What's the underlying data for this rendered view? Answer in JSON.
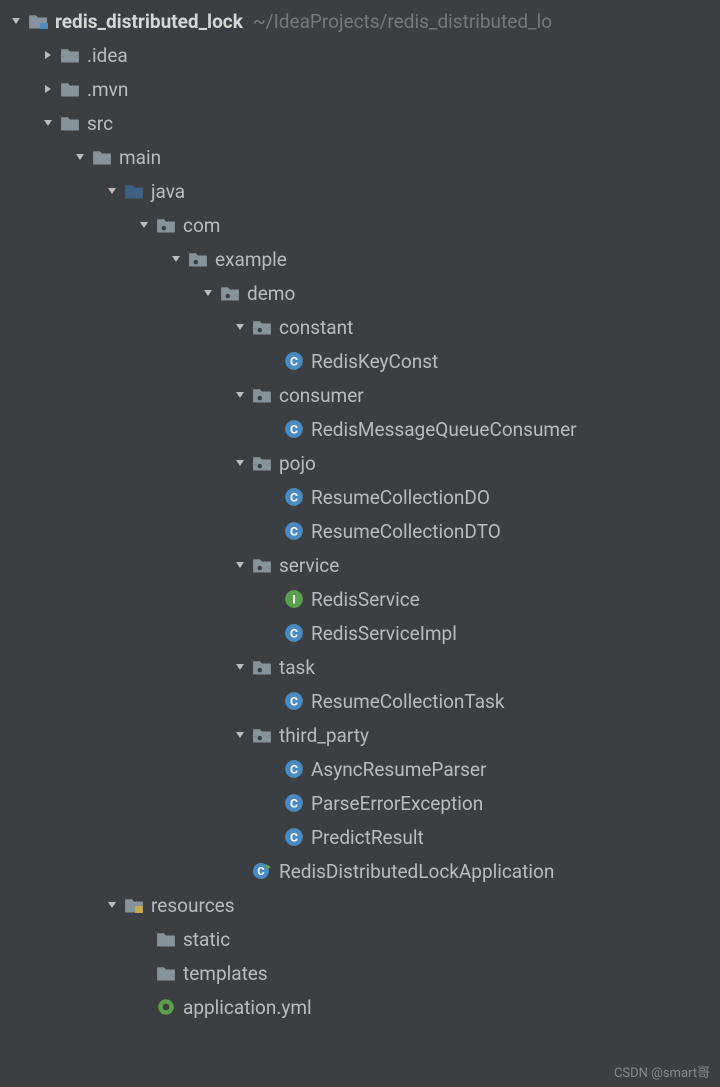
{
  "root": {
    "name": "redis_distributed_lock",
    "path": "~/IdeaProjects/redis_distributed_lo"
  },
  "nodes": {
    "idea": ".idea",
    "mvn": ".mvn",
    "src": "src",
    "main": "main",
    "java": "java",
    "com": "com",
    "example": "example",
    "demo": "demo",
    "constant": "constant",
    "redisKeyConst": "RedisKeyConst",
    "consumer": "consumer",
    "redisMessageQueueConsumer": "RedisMessageQueueConsumer",
    "pojo": "pojo",
    "resumeCollectionDO": "ResumeCollectionDO",
    "resumeCollectionDTO": "ResumeCollectionDTO",
    "service": "service",
    "redisService": "RedisService",
    "redisServiceImpl": "RedisServiceImpl",
    "task": "task",
    "resumeCollectionTask": "ResumeCollectionTask",
    "thirdParty": "third_party",
    "asyncResumeParser": "AsyncResumeParser",
    "parseErrorException": "ParseErrorException",
    "predictResult": "PredictResult",
    "redisDistributedLockApplication": "RedisDistributedLockApplication",
    "resources": "resources",
    "static": "static",
    "templates": "templates",
    "applicationYml": "application.yml"
  },
  "watermark": "CSDN @smart哥"
}
